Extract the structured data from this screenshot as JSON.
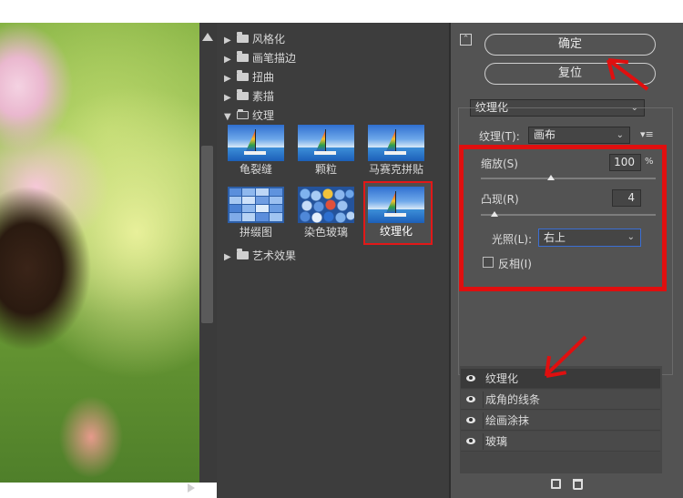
{
  "categories": [
    {
      "label": "风格化",
      "expanded": false
    },
    {
      "label": "画笔描边",
      "expanded": false
    },
    {
      "label": "扭曲",
      "expanded": false
    },
    {
      "label": "素描",
      "expanded": false
    },
    {
      "label": "纹理",
      "expanded": true
    },
    {
      "label": "艺术效果",
      "expanded": false
    }
  ],
  "texture_filters": [
    "龟裂缝",
    "颗粒",
    "马赛克拼贴",
    "拼缀图",
    "染色玻璃",
    "纹理化"
  ],
  "selected_filter": "纹理化",
  "buttons": {
    "ok": "确定",
    "reset": "复位"
  },
  "filter_select": "纹理化",
  "texture": {
    "label": "纹理(T):",
    "value": "画布"
  },
  "scaling": {
    "label": "缩放(S)",
    "value": "100",
    "unit": "%",
    "level": 0.4
  },
  "relief": {
    "label": "凸现(R)",
    "value": "4",
    "level": 0.08
  },
  "light": {
    "label": "光照(L):",
    "value": "右上"
  },
  "invert": {
    "label": "反相(I)",
    "checked": false
  },
  "effect_layers": [
    "纹理化",
    "成角的线条",
    "绘画涂抹",
    "玻璃"
  ],
  "colors": {
    "accent_red": "#e00f0f",
    "panel_bg": "#535353",
    "gallery_bg": "#3d3d3d"
  }
}
